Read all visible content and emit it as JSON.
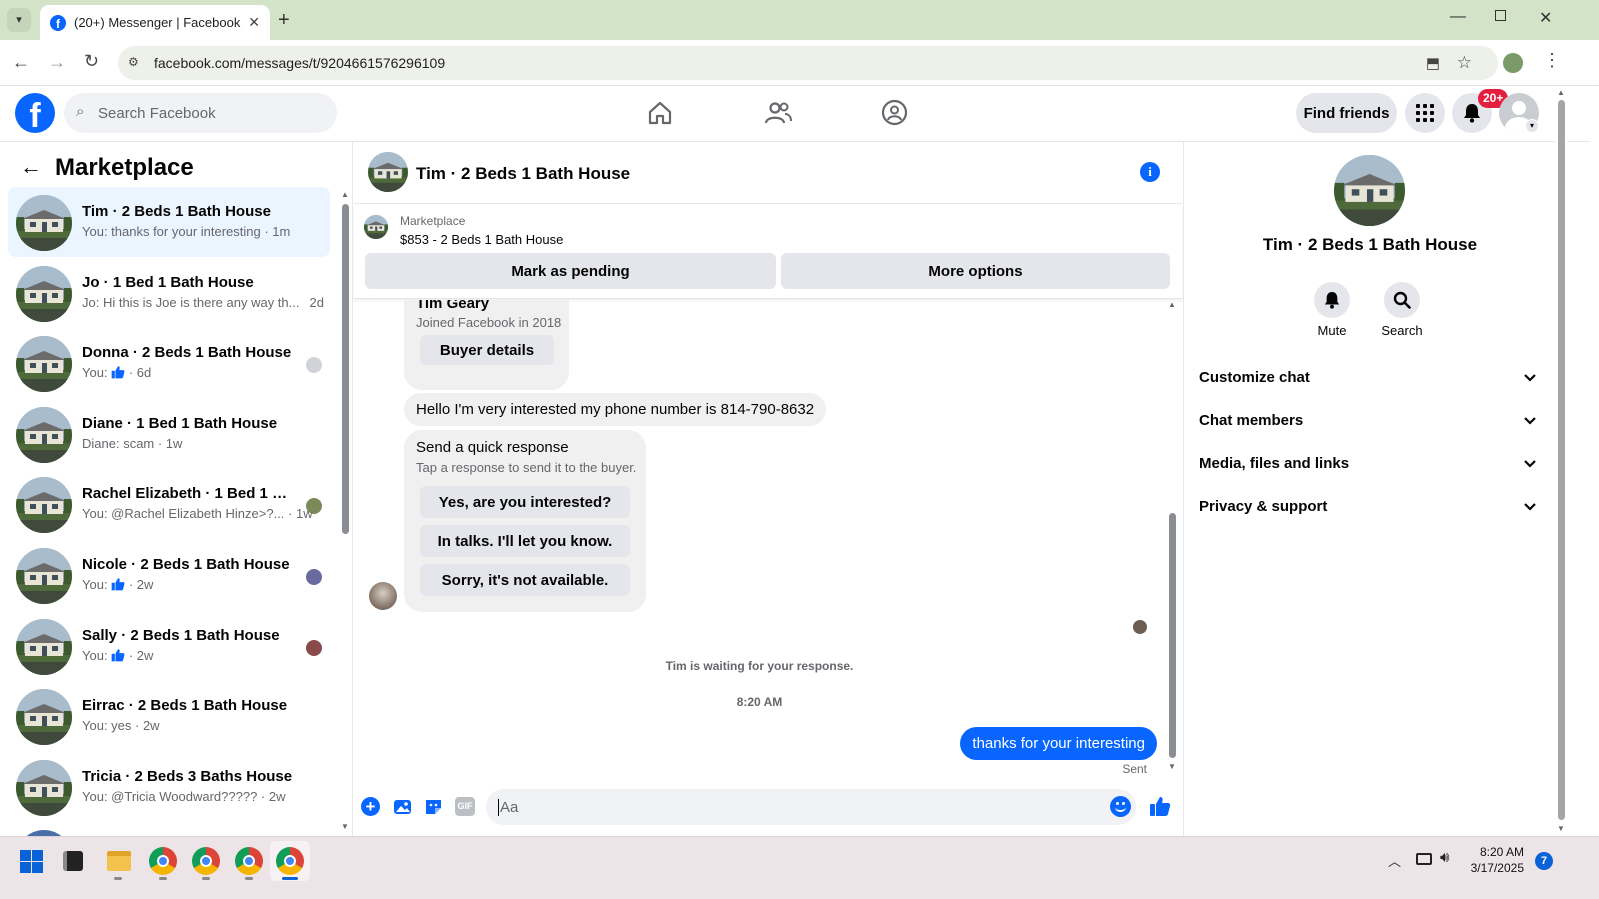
{
  "browser": {
    "tab_title": "(20+) Messenger | Facebook",
    "url": "facebook.com/messages/t/9204661576296109"
  },
  "fb_header": {
    "search_placeholder": "Search Facebook",
    "find_friends": "Find friends",
    "notif_badge": "20+"
  },
  "left": {
    "title": "Marketplace",
    "conversations": [
      {
        "name": "Tim · 2 Beds 1 Bath House",
        "preview": "You: thanks for your interesting · 1m",
        "active": true
      },
      {
        "name": "Jo · 1 Bed 1 Bath House",
        "preview": "Jo: Hi this is Joe is there any way th...",
        "time": "2d"
      },
      {
        "name": "Donna · 2 Beds 1 Bath House",
        "preview_prefix": "You:",
        "preview_suffix": "· 6d"
      },
      {
        "name": "Diane · 1 Bed 1 Bath House",
        "preview": "Diane: scam · 1w"
      },
      {
        "name": "Rachel Elizabeth · 1 Bed 1 Bath...",
        "preview": "You: @Rachel Elizabeth Hinze>?... · 1w"
      },
      {
        "name": "Nicole · 2 Beds 1 Bath House",
        "preview_prefix": "You:",
        "preview_suffix": "· 2w"
      },
      {
        "name": "Sally · 2 Beds 1 Bath House",
        "preview_prefix": "You:",
        "preview_suffix": "· 2w"
      },
      {
        "name": "Eirrac · 2 Beds 1 Bath House",
        "preview": "You: yes · 2w"
      },
      {
        "name": "Tricia · 2 Beds 3 Baths House",
        "preview": "You: @Tricia Woodward????? · 2w"
      }
    ]
  },
  "chat": {
    "title": "Tim · 2 Beds 1 Bath House",
    "pinned_label": "Marketplace",
    "pinned_item": "$853 - 2 Beds 1 Bath House",
    "mark_pending": "Mark as pending",
    "more_options": "More options",
    "buyer_name": "Tim Geary",
    "buyer_joined": "Joined Facebook in 2018",
    "buyer_details": "Buyer details",
    "message_in": "Hello I'm very interested my phone number is 814-790-8632",
    "quick_title": "Send a quick response",
    "quick_sub": "Tap a response to send it to the buyer.",
    "quick_responses": [
      "Yes, are you interested?",
      "In talks. I'll let you know.",
      "Sorry, it's not available."
    ],
    "waiting": "Tim is waiting for your response.",
    "time": "8:20 AM",
    "message_out": "thanks for your interesting",
    "sent": "Sent",
    "composer_placeholder": "Aa"
  },
  "right": {
    "title": "Tim · 2 Beds 1 Bath House",
    "mute": "Mute",
    "search": "Search",
    "sections": [
      "Customize chat",
      "Chat members",
      "Media, files and links",
      "Privacy & support"
    ]
  },
  "taskbar": {
    "time": "8:20 AM",
    "date": "3/17/2025",
    "notif_count": "7"
  },
  "colors": {
    "fb_blue": "#0866ff",
    "active_bg": "#ebf5ff",
    "tab_bar": "#d3e3c7"
  }
}
